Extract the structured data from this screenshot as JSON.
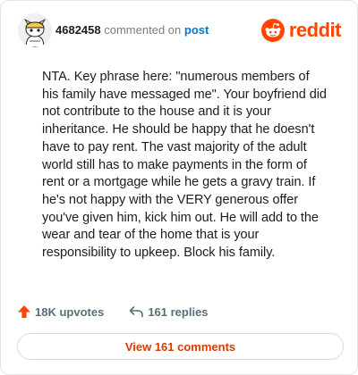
{
  "header": {
    "username": "4682458",
    "action_text": "commented on",
    "post_link": "post",
    "brand_name": "reddit"
  },
  "comment": {
    "body": "NTA. Key phrase here: \"numerous members of his family have messaged me\". Your boyfriend did not contribute to the house and it is your inheritance. He should be happy that he doesn't have to pay rent. The vast majority of the adult world still has to make payments in the form of rent or a mortgage while he gets a gravy train. If he's not happy with the VERY generous offer you've given him, kick him out. He will add to the wear and tear of the home that is your responsibility to upkeep. Block his family."
  },
  "actions": {
    "upvotes_label": "18K upvotes",
    "replies_label": "161 replies"
  },
  "footer": {
    "view_comments_label": "View 161 comments"
  },
  "colors": {
    "brand": "#ff4500",
    "link": "#0079d3",
    "upvote": "#ff4500",
    "button_text": "#d93a00"
  },
  "icons": {
    "avatar": "snoo-avatar-icon",
    "brand": "reddit-logo-icon",
    "upvote": "upvote-arrow-icon",
    "reply": "reply-arrow-icon"
  }
}
